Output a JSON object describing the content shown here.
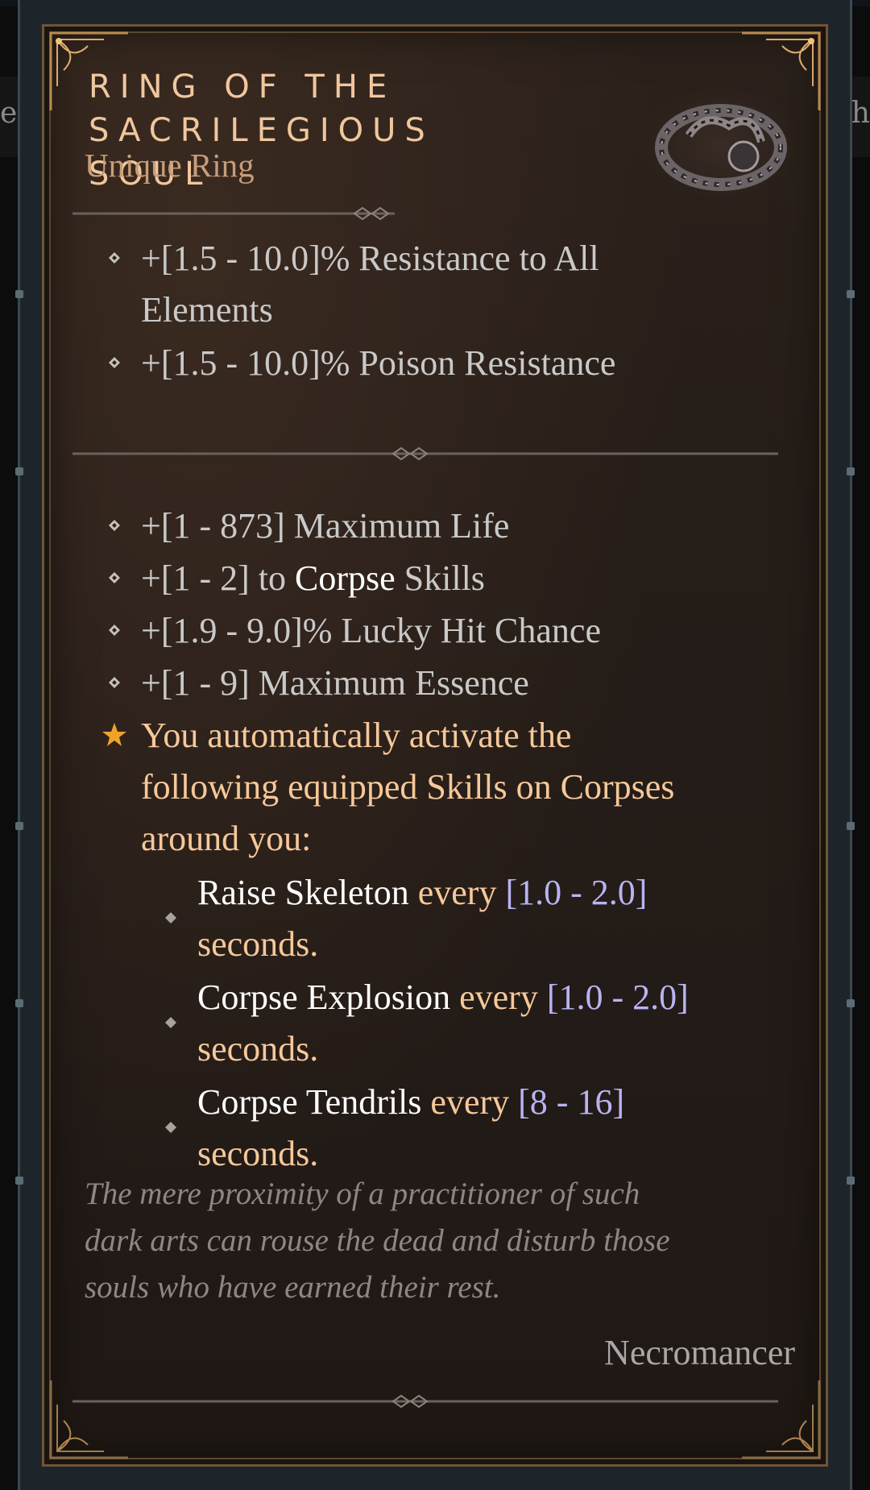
{
  "background": {
    "left_edge_text": "e",
    "right_edge_text": "th"
  },
  "item": {
    "name_line1": "RING OF THE",
    "name_line2": "SACRILEGIOUS SOUL",
    "type": "Unique Ring",
    "icon": "ring-icon",
    "implicit_affixes": [
      {
        "line1": "+[1.5 - 10.0]% Resistance to All",
        "line2": "Elements"
      },
      {
        "line1": "+[1.5 - 10.0]% Poison Resistance"
      }
    ],
    "affixes": {
      "max_life": "+[1 - 873] Maximum Life",
      "corpse_prefix": "+[1 - 2] to ",
      "corpse_word": "Corpse",
      "corpse_suffix": " Skills",
      "lucky_hit": "+[1.9 - 9.0]% Lucky Hit Chance",
      "max_essence": "+[1 - 9] Maximum Essence"
    },
    "unique_power": {
      "line1": "You automatically activate the",
      "line2": "following equipped Skills on Corpses",
      "line3": "around you:",
      "skills": [
        {
          "name": "Raise Skeleton",
          "every": " every ",
          "range": "[1.0 - 2.0]",
          "unit": "seconds."
        },
        {
          "name": "Corpse Explosion",
          "every": " every ",
          "range": "[1.0 - 2.0]",
          "unit": "seconds."
        },
        {
          "name": "Corpse Tendrils",
          "every": " every ",
          "range": "[8 - 16]",
          "unit": "seconds."
        }
      ]
    },
    "flavor": {
      "line1": "The mere proximity of a practitioner of such",
      "line2": "dark arts can rouse the dead and disturb those",
      "line3": "souls who have earned their rest."
    },
    "class_requirement": "Necromancer"
  },
  "colors": {
    "title": "#f0c79d",
    "unique_text": "#f6c899",
    "range_value": "#b8b4f2",
    "affix_text": "#c9c9c9",
    "flavor_text": "#8d8782"
  }
}
